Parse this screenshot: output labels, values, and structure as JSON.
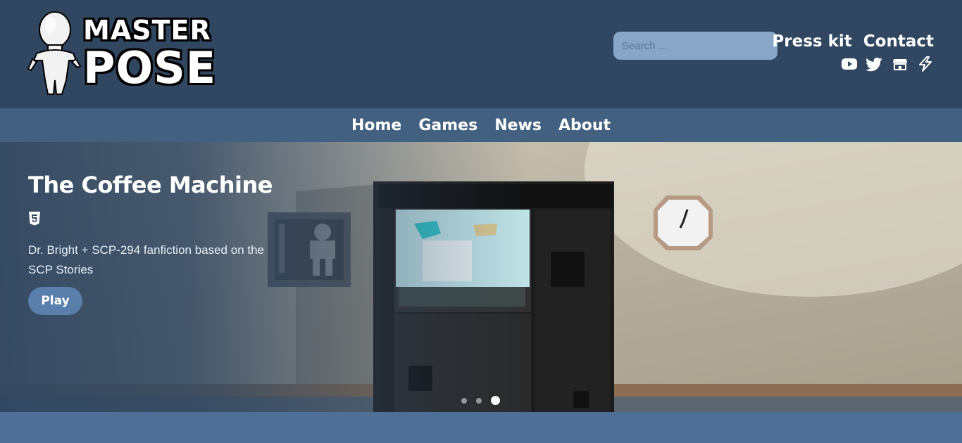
{
  "brand": {
    "line1": "MASTER",
    "line2": "POSE"
  },
  "search": {
    "placeholder": "Search ..."
  },
  "top_links": {
    "press_kit": "Press kit",
    "contact": "Contact"
  },
  "social": [
    "youtube-icon",
    "twitter-icon",
    "store-icon",
    "lightning-icon"
  ],
  "nav": {
    "home": "Home",
    "games": "Games",
    "news": "News",
    "about": "About"
  },
  "hero": {
    "title": "The Coffee Machine",
    "description": "Dr. Bright + SCP-294 fanfiction based on the SCP Stories",
    "play_label": "Play",
    "slides": 3,
    "active_slide": 3
  },
  "colors": {
    "header": "#314761",
    "nav": "#42607f",
    "button": "#5a7fab",
    "search": "#87a6c8"
  }
}
